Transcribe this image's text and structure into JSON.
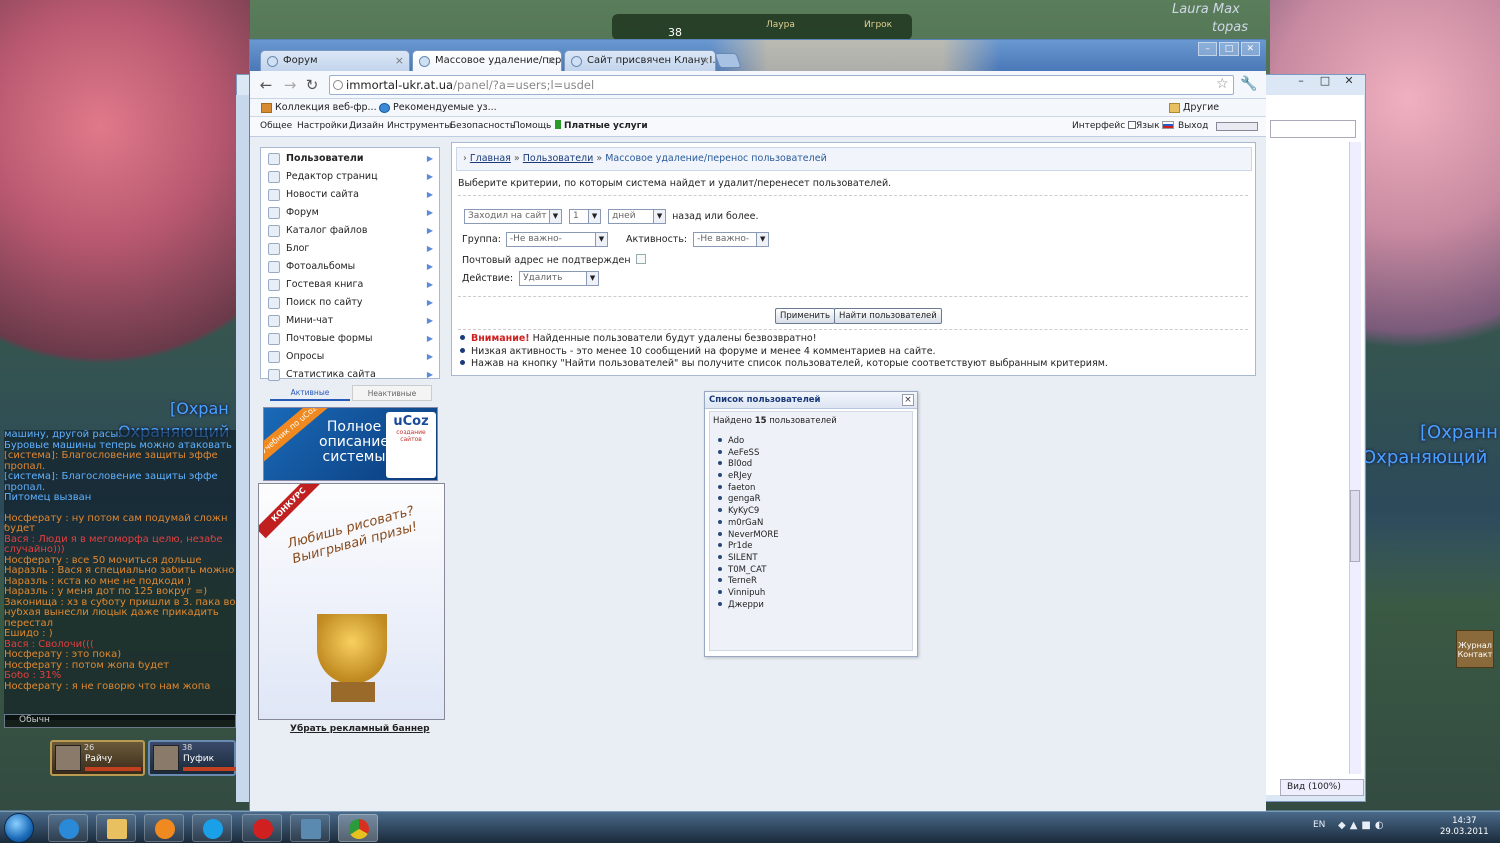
{
  "desktop": {
    "top_names": [
      "Laura Max",
      "topas"
    ],
    "hud": {
      "level": "38",
      "name1": "Лаура",
      "name2": "Игрок"
    },
    "game_title_left": "[Охран",
    "game_sub_left": "Охраняющий",
    "game_title_right": "[Охранн",
    "game_sub_right": "Охраняющий",
    "chat_lines": [
      {
        "text": "машину, другой расы.",
        "color": "blue"
      },
      {
        "text": "Буровые машины теперь можно атаковать",
        "color": "blue"
      },
      {
        "text": "[система]: Благословение защиты эффе",
        "color": "orange"
      },
      {
        "text": "пропал.",
        "color": "orange"
      },
      {
        "text": "[система]: Благословение защиты эффе",
        "color": "blue"
      },
      {
        "text": "пропал.",
        "color": "blue"
      },
      {
        "text": "Питомец вызван",
        "color": "blue"
      },
      {
        "text": "",
        "color": "sep"
      },
      {
        "text": "Носферату : ну потом сам подумай сложн",
        "color": "orange"
      },
      {
        "text": "будет",
        "color": "orange"
      },
      {
        "text": "Вася : Люди я в мегоморфа целю, незабе",
        "color": "red"
      },
      {
        "text": "случайно)))",
        "color": "red"
      },
      {
        "text": "Носферату : все 50 мочиться дольше",
        "color": "orange"
      },
      {
        "text": "Наразль : Вася я специально забить можно",
        "color": "orange"
      },
      {
        "text": "Наразль : кста ко мне не подкоди )",
        "color": "orange"
      },
      {
        "text": "Наразль : у меня дот по 125 вокруг =)",
        "color": "orange"
      },
      {
        "text": "Законища : хз в суботу пришли в 3. пака во",
        "color": "orange"
      },
      {
        "text": "нубхая вынесли люцык даже прикадить",
        "color": "orange"
      },
      {
        "text": "перестал",
        "color": "orange"
      },
      {
        "text": "Ешидо : )",
        "color": "orange"
      },
      {
        "text": "Вася : Сволочи(((",
        "color": "red"
      },
      {
        "text": "Носферату : это пока)",
        "color": "orange"
      },
      {
        "text": "Носферату : потом жопа будет",
        "color": "orange"
      },
      {
        "text": "Бобо : 31%",
        "color": "red"
      },
      {
        "text": "Носферату : я не говорю что нам жопа",
        "color": "orange"
      }
    ],
    "chat_mode": "Обычн",
    "party": [
      {
        "level": "26",
        "name": "Райчу"
      },
      {
        "level": "38",
        "name": "Пуфик"
      }
    ],
    "journal": "Журнал Контакт"
  },
  "bg_window": {
    "status_zoom": "Вид (100%)"
  },
  "browser": {
    "tabs": [
      {
        "label": "Форум",
        "active": false
      },
      {
        "label": "Массовое удаление/пер...",
        "active": true
      },
      {
        "label": "Сайт присвячен Клану I...",
        "active": false
      }
    ],
    "url_host": "immortal-ukr.at.ua",
    "url_path": "/panel/?a=users;l=usdel",
    "bookmarks": [
      "Коллекция веб-фр...",
      "Рекомендуемые уз..."
    ],
    "other_bookmarks": "Другие закладки"
  },
  "menubar": {
    "items": [
      "Общее",
      "Настройки",
      "Дизайн",
      "Инструменты",
      "Безопасность",
      "Помощь"
    ],
    "paid": "Платные услуги",
    "interface": "Интерфейс",
    "language": "Язык",
    "logout": "Выход"
  },
  "sidebar": {
    "items": [
      "Пользователи",
      "Редактор страниц",
      "Новости сайта",
      "Форум",
      "Каталог файлов",
      "Блог",
      "Фотоальбомы",
      "Гостевая книга",
      "Поиск по сайту",
      "Мини-чат",
      "Почтовые формы",
      "Опросы",
      "Статистика сайта"
    ],
    "tab_active": "Активные",
    "tab_inactive": "Неактивные",
    "ad1_ribbon": "Учебник по uCoz",
    "ad1_text": "Полное описание системы",
    "ad1_logo": "uCoz",
    "ad1_logo_sub": "создание сайтов",
    "ad2_badge": "КОНКУРС",
    "ad2_slogan": "Любишь рисовать? Выигрывай призы!",
    "remove_banner": "Убрать рекламный баннер"
  },
  "panel": {
    "crumb_home": "Главная",
    "crumb_users": "Пользователи",
    "crumb_current": "Массовое удаление/перенос пользователей",
    "crumb_sep": "»",
    "intro": "Выберите критерии, по которым система найдет и удалит/перенесет пользователей.",
    "criteria_select": "Заходил на сайт",
    "count_select": "1",
    "unit_select": "дней",
    "ago_text": "назад или более.",
    "group_label": "Группа:",
    "group_value": "-Не важно-",
    "activity_label": "Активность:",
    "activity_value": "-Не важно-",
    "email_label": "Почтовый адрес не подтвержден",
    "action_label": "Действие:",
    "action_value": "Удалить",
    "apply_button": "Применить",
    "find_button": "Найти пользователей",
    "notes": [
      {
        "warn": "Внимание!",
        "text": " Найденные пользователи будут удалены безвозвратно!"
      },
      {
        "warn": "",
        "text": "Низкая активность - это менее 10 сообщений на форуме и менее 4 комментариев на сайте."
      },
      {
        "warn": "",
        "text": "Нажав на кнопку \"Найти пользователей\" вы получите список пользователей, которые соответствуют выбранным критериям."
      }
    ]
  },
  "popup": {
    "title": "Список пользователей",
    "found_prefix": "Найдено",
    "found_count": "15",
    "found_suffix": "пользователей",
    "users": [
      "Ado",
      "AeFeSS",
      "Bl0od",
      "eRJey",
      "faeton",
      "gengaR",
      "KyKyC9",
      "m0rGaN",
      "NeverMORE",
      "Pr1de",
      "SILENT",
      "T0M_CAT",
      "TerneR",
      "Vinnipuh",
      "Джерри"
    ]
  },
  "taskbar": {
    "lang": "EN",
    "time": "14:37",
    "date": "29.03.2011"
  }
}
